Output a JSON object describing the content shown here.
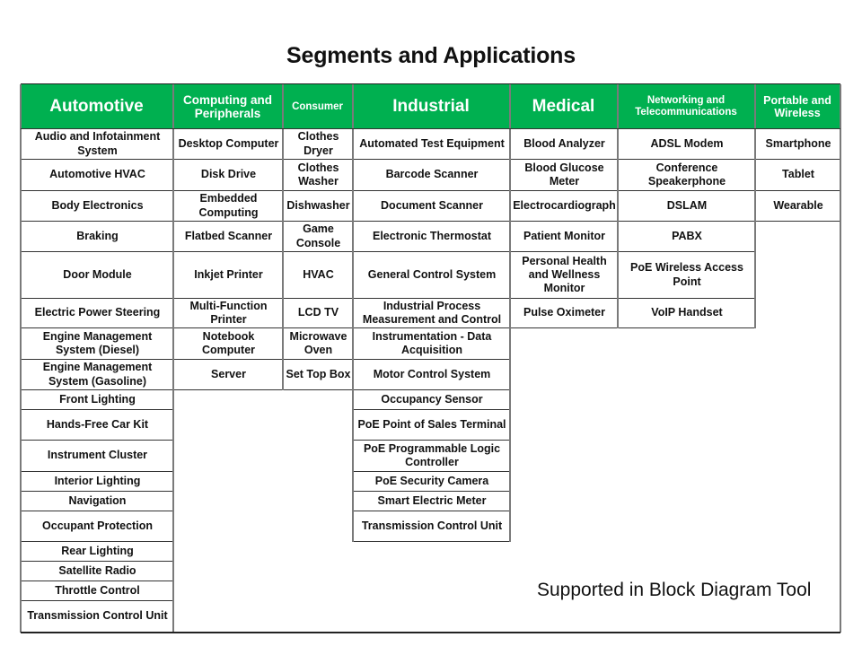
{
  "title": "Segments and Applications",
  "header_color": "#00b050",
  "columns": [
    {
      "label": "Automotive",
      "items": [
        "Audio and Infotainment System",
        "Automotive HVAC",
        "Body Electronics",
        "Braking",
        "Door Module",
        "Electric Power Steering",
        "Engine Management System (Diesel)",
        "Engine Management System (Gasoline)",
        "Front Lighting",
        "Hands-Free Car Kit",
        "Instrument Cluster",
        "Interior Lighting",
        "Navigation",
        "Occupant Protection",
        "Rear Lighting",
        "Satellite Radio",
        "Throttle Control",
        "Transmission Control Unit"
      ]
    },
    {
      "label": "Computing and Peripherals",
      "items": [
        "Desktop Computer",
        "Disk Drive",
        "Embedded Computing",
        "Flatbed Scanner",
        "Inkjet Printer",
        "Multi-Function Printer",
        "Notebook Computer",
        "Server"
      ]
    },
    {
      "label": "Consumer",
      "items": [
        "Clothes Dryer",
        "Clothes Washer",
        "Dishwasher",
        "Game Console",
        "HVAC",
        "LCD TV",
        "Microwave Oven",
        "Set Top Box"
      ]
    },
    {
      "label": "Industrial",
      "items": [
        "Automated Test Equipment",
        "Barcode Scanner",
        "Document Scanner",
        "Electronic Thermostat",
        "General Control System",
        "Industrial Process Measurement and Control",
        "Instrumentation - Data Acquisition",
        "Motor Control System",
        "Occupancy Sensor",
        "PoE Point of Sales Terminal",
        "PoE Programmable Logic Controller",
        "PoE Security Camera",
        "Smart Electric Meter",
        "Transmission Control Unit"
      ]
    },
    {
      "label": "Medical",
      "items": [
        "Blood Analyzer",
        "Blood Glucose Meter",
        "Electrocardiograph",
        "Patient Monitor",
        "Personal Health and Wellness Monitor",
        "Pulse Oximeter"
      ]
    },
    {
      "label": "Networking and Telecommunications",
      "items": [
        "ADSL  Modem",
        "Conference Speakerphone",
        "DSLAM",
        "PABX",
        "PoE Wireless Access Point",
        "VoIP Handset"
      ]
    },
    {
      "label": "Portable and Wireless",
      "items": [
        "Smartphone",
        "Tablet",
        "Wearable"
      ]
    }
  ],
  "note": "Supported in Block Diagram Tool"
}
